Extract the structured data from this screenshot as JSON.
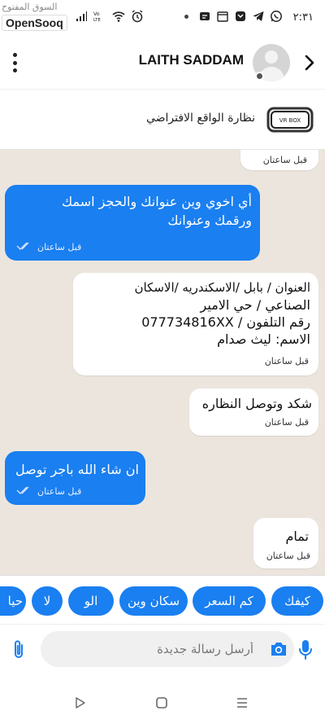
{
  "status_bar": {
    "time": "٢:٣١",
    "indicators": [
      "wifi-icon",
      "lte-icon",
      "signal-icon",
      "alarm-icon",
      "whatsapp-icon",
      "telegram-icon",
      "notification-icon"
    ]
  },
  "watermark": {
    "top_text": "السوق المفتوح",
    "logo_text": "OpenSooq"
  },
  "header": {
    "contact_name": "LAITH SADDAM"
  },
  "product": {
    "title": "نظارة الواقع الافتراضي",
    "thumb_label": "VR BOX"
  },
  "messages": [
    {
      "direction": "in",
      "lines": [],
      "time": "قبل ساعتان"
    },
    {
      "direction": "out",
      "lines": [
        "أي اخوي وين عنوانك والحجز اسمك",
        "ورقمك وعنوانك"
      ],
      "time": "قبل ساعتان"
    },
    {
      "direction": "in",
      "lines": [
        "العنوان / بابل /الاسكندريه /الاسكان",
        "الصناعي / حي الامير",
        "رقم التلفون / 077734816XX",
        "الاسم:  ليث صدام"
      ],
      "time": "قبل ساعتان"
    },
    {
      "direction": "in",
      "lines": [
        "شكد وتوصل النظاره"
      ],
      "time": "قبل ساعتان"
    },
    {
      "direction": "out",
      "lines": [
        "ان شاء الله باجر توصل"
      ],
      "time": "قبل ساعتان"
    },
    {
      "direction": "in",
      "lines": [
        "تمام"
      ],
      "time": "قبل ساعتان"
    }
  ],
  "quick_replies": [
    "كيفك",
    "كم السعر",
    "سكان وين",
    "الو",
    "لا",
    "حيا"
  ],
  "composer": {
    "placeholder": "أرسل رسالة جديدة"
  },
  "colors": {
    "accent": "#1a7ff0",
    "chat_background": "#ece5dd",
    "incoming_bubble": "#ffffff"
  }
}
